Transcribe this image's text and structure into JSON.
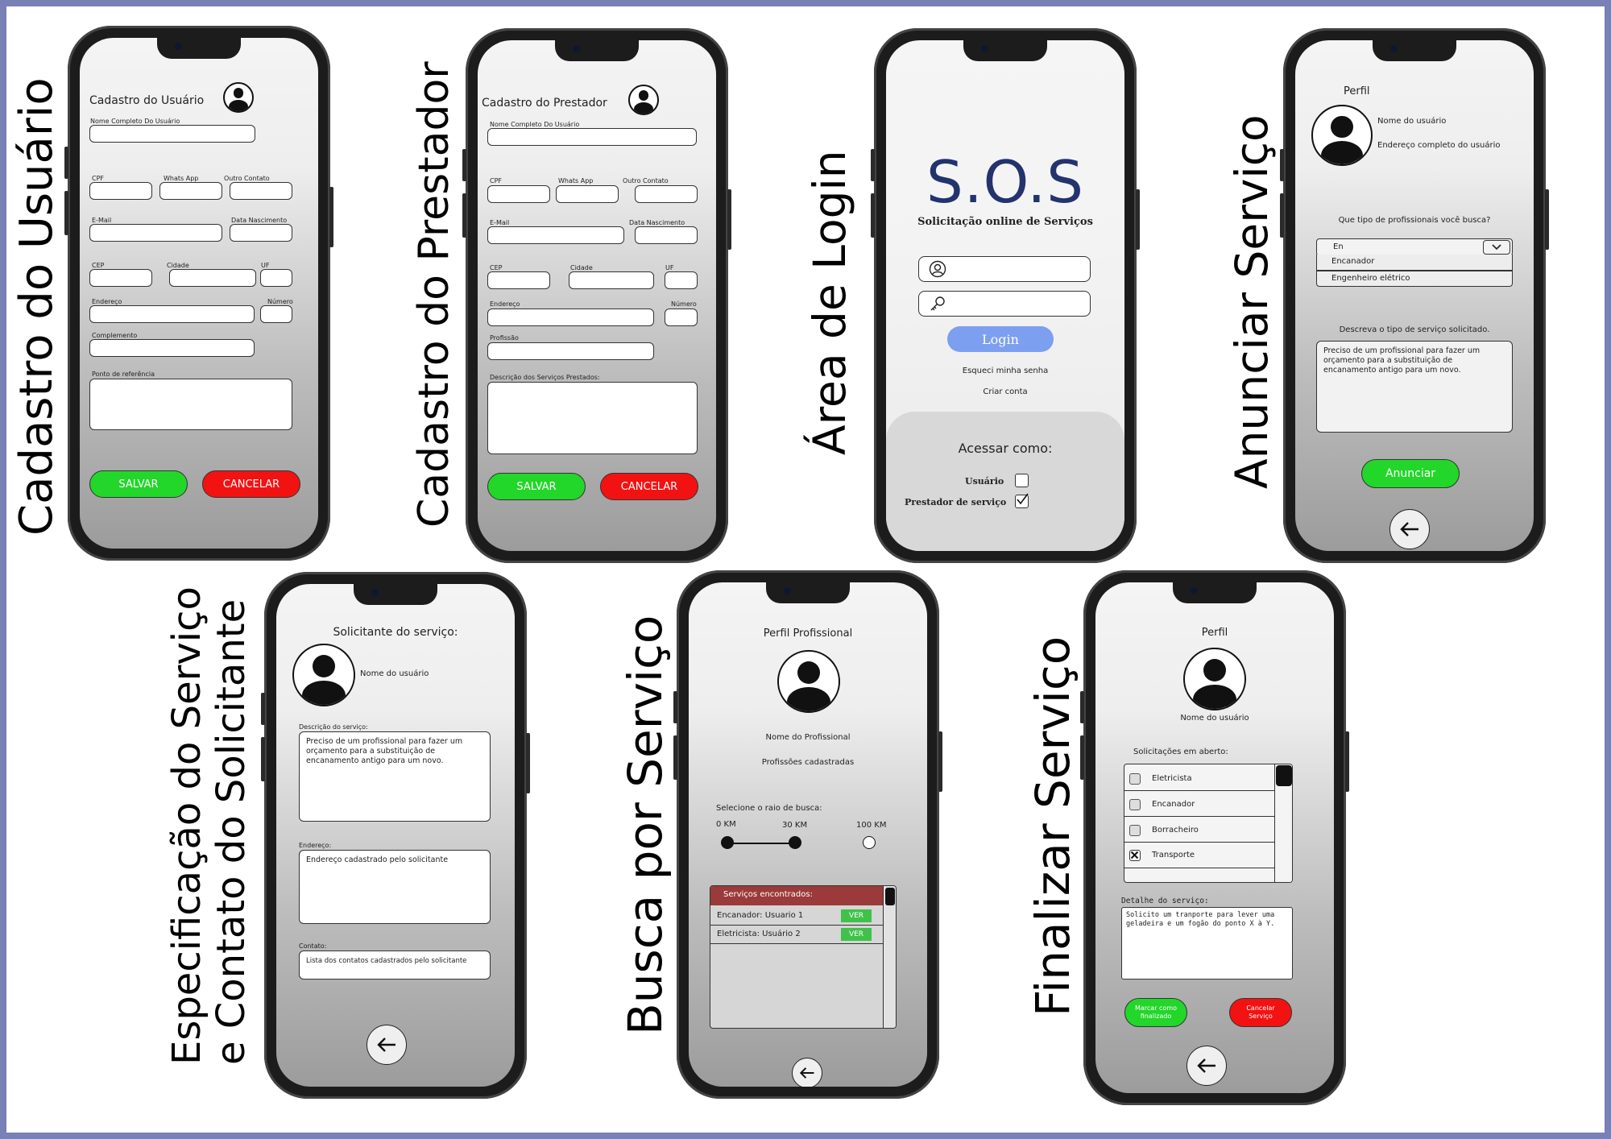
{
  "labels": {
    "cadastro_usuario": "Cadastro do Usuário",
    "cadastro_prestador": "Cadastro do Prestador",
    "area_login": "Área de Login",
    "anunciar_servico": "Anunciar Serviço",
    "especificacao_l1": "Especificação do Serviço",
    "especificacao_l2": "e Contato do Solicitante",
    "busca_servico": "Busca por Serviço",
    "finalizar_servico": "Finalizar Serviço"
  },
  "s1": {
    "title": "Cadastro do Usuário",
    "nome": "Nome Completo Do Usuário",
    "cpf": "CPF",
    "whats": "Whats App",
    "outro": "Outro Contato",
    "email": "E-Mail",
    "nasc": "Data Nascimento",
    "cep": "CEP",
    "cidade": "Cidade",
    "uf": "UF",
    "endereco": "Endereço",
    "numero": "Número",
    "complemento": "Complemento",
    "referencia": "Ponto de referência",
    "salvar": "SALVAR",
    "cancelar": "CANCELAR"
  },
  "s2": {
    "title": "Cadastro do Prestador",
    "nome": "Nome Completo Do Usuário",
    "cpf": "CPF",
    "whats": "Whats App",
    "outro": "Outro Contato",
    "email": "E-Mail",
    "nasc": "Data Nascimento",
    "cep": "CEP",
    "cidade": "Cidade",
    "uf": "UF",
    "endereco": "Endereço",
    "numero": "Número",
    "profissao": "Profissão",
    "descricao": "Descrição dos Serviços Prestados:",
    "salvar": "SALVAR",
    "cancelar": "CANCELAR"
  },
  "s3": {
    "logo": "S.O.S",
    "subtitle": "Solicitação online de Serviços",
    "login": "Login",
    "esqueci": "Esqueci minha senha",
    "criar": "Criar conta",
    "acessar": "Acessar como:",
    "usuario": "Usuário",
    "prestador": "Prestador de serviço"
  },
  "s4": {
    "title": "Perfil",
    "nome": "Nome do usuário",
    "endereco": "Endereço completo do usuário",
    "pergunta": "Que tipo de profissionais você busca?",
    "select_value": "En",
    "options": [
      "Encanador",
      "Engenheiro elétrico"
    ],
    "descreva": "Descreva o tipo de serviço solicitado.",
    "descricao": "Preciso de um profissional para fazer um orçamento para a substituição de encanamento antigo para um novo.",
    "anunciar": "Anunciar"
  },
  "s5": {
    "title": "Solicitante do serviço:",
    "nome": "Nome do usuário",
    "desc_label": "Descrição do serviço:",
    "descricao": "Preciso de um profissional para fazer um orçamento para a substituição de encanamento antigo para um novo.",
    "end_label": "Endereço:",
    "endereco": "Endereço cadastrado pelo solicitante",
    "contato_label": "Contato:",
    "contato": "Lista dos contatos cadastrados pelo solicitante"
  },
  "s6": {
    "title": "Perfil Profissional",
    "nome": "Nome do Profissional",
    "profissoes": "Profissões cadastradas",
    "raio": "Selecione o raio de busca:",
    "km0": "0 KM",
    "km30": "30 KM",
    "km100": "100 KM",
    "radius_selected_km": 30,
    "encontrados": "Serviços encontrados:",
    "results": [
      {
        "label": "Encanador: Usuario 1",
        "action": "VER"
      },
      {
        "label": "Eletricista: Usuário 2",
        "action": "VER"
      }
    ]
  },
  "s7": {
    "title": "Perfil",
    "nome": "Nome do usuário",
    "abertas": "Solicitações em aberto:",
    "items": [
      {
        "label": "Eletricista",
        "checked": false
      },
      {
        "label": "Encanador",
        "checked": false
      },
      {
        "label": "Borracheiro",
        "checked": false
      },
      {
        "label": "Transporte",
        "checked": true
      }
    ],
    "detalhe_label": "Detalhe do serviço:",
    "detalhe": "Solicito um tranporte para lever uma geladeira e um fogão do ponto X à Y.",
    "finalizar_l1": "Marcar como",
    "finalizar_l2": "finalizado",
    "cancelar_l1": "Cancelar",
    "cancelar_l2": "Serviço"
  },
  "colors": {
    "border": "#7880b6",
    "green": "#23d62a",
    "red": "#f31212",
    "login_blue": "#7d9ff0",
    "sos_navy": "#23336e",
    "results_header": "#9b3a3a"
  }
}
